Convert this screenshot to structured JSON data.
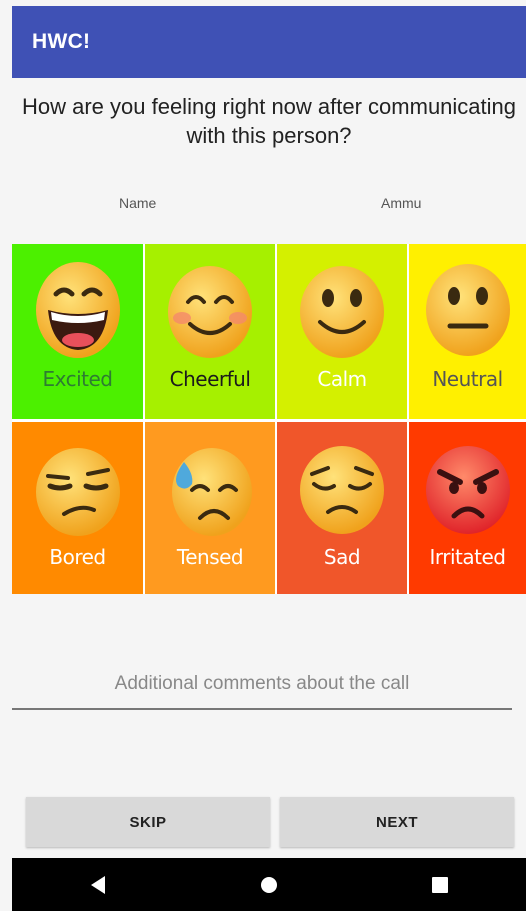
{
  "app_bar": {
    "title": "HWC!",
    "color": "#3f51b5"
  },
  "question": "How are you feeling right now after communicating with this person?",
  "contact": {
    "name_label": "Name",
    "name_value": "Ammu"
  },
  "emotions": [
    {
      "label": "Excited",
      "bg": "#4cf000",
      "text_color": "#2e7d32",
      "face": "grinning"
    },
    {
      "label": "Cheerful",
      "bg": "#a6f000",
      "text_color": "#1b1b1b",
      "face": "smiling-blush"
    },
    {
      "label": "Calm",
      "bg": "#d4f000",
      "text_color": "#ffffff",
      "face": "slight-smile"
    },
    {
      "label": "Neutral",
      "bg": "#fff000",
      "text_color": "#555555",
      "face": "neutral"
    },
    {
      "label": "Bored",
      "bg": "#ff8a00",
      "text_color": "#ffffff",
      "face": "unamused"
    },
    {
      "label": "Tensed",
      "bg": "#ff9a1f",
      "text_color": "#ffffff",
      "face": "sweat"
    },
    {
      "label": "Sad",
      "bg": "#f0562a",
      "text_color": "#ffffff",
      "face": "pensive"
    },
    {
      "label": "Irritated",
      "bg": "#ff3a00",
      "text_color": "#ffffff",
      "face": "angry"
    }
  ],
  "comments": {
    "placeholder": "Additional comments about the call",
    "value": ""
  },
  "buttons": {
    "skip": "SKIP",
    "next": "NEXT"
  },
  "navigation": {
    "back": "back-icon",
    "home": "home-icon",
    "recents": "recents-icon"
  }
}
